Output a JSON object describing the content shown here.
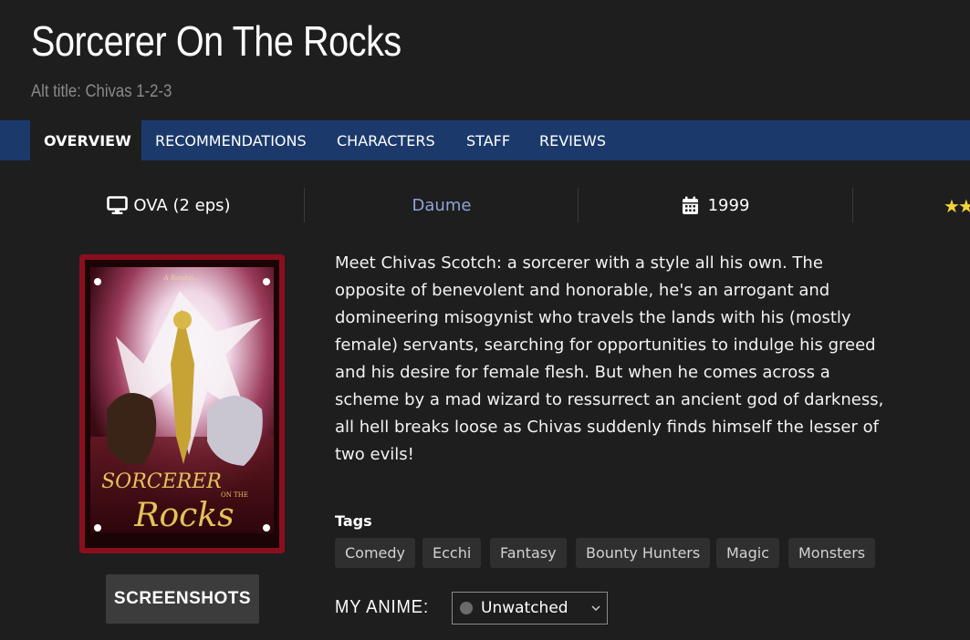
{
  "page": {
    "title": "Sorcerer On The Rocks",
    "alt_title": "Alt title: Chivas 1-2-3"
  },
  "tabs": [
    {
      "label": "OVERVIEW",
      "active": true
    },
    {
      "label": "RECOMMENDATIONS",
      "active": false
    },
    {
      "label": "CHARACTERS",
      "active": false
    },
    {
      "label": "STAFF",
      "active": false
    },
    {
      "label": "REVIEWS",
      "active": false
    }
  ],
  "stats": {
    "type": {
      "icon": "monitor-icon",
      "label": "OVA (2 eps)"
    },
    "studio": {
      "label": "Daume",
      "color": "#8fa3d6"
    },
    "year": {
      "icon": "calendar-icon",
      "label": "1999"
    },
    "rating": {
      "icon": "star-icon",
      "glyphs": "★★"
    }
  },
  "cover": {
    "title_art": "SORCERER",
    "title_art_2": "ON THE",
    "title_art_3": "Rocks",
    "top_text": "A Bandai..."
  },
  "screenshots_button": "SCREENSHOTS",
  "synopsis": "Meet Chivas Scotch: a sorcerer with a style all his own. The opposite of benevolent and honorable, he's an arrogant and domineering misogynist who travels the lands with his (mostly female) servants, searching for opportunities to indulge his greed and his desire for female flesh. But when he comes across a scheme by a mad wizard to ressurrect an ancient god of darkness, all hell breaks loose as Chivas suddenly finds himself the lesser of two evils!",
  "tags": {
    "label": "Tags",
    "items": [
      "Comedy",
      "Ecchi",
      "Fantasy",
      "Bounty Hunters",
      "Magic",
      "Monsters"
    ]
  },
  "my_anime": {
    "label": "MY ANIME:",
    "status": "Unwatched"
  },
  "colors": {
    "background": "#1e1e1e",
    "tab_bar": "#1b3a6b",
    "studio_link": "#8fa3d6",
    "star": "#f2d33a",
    "tag_bg": "#2f2f2f"
  }
}
